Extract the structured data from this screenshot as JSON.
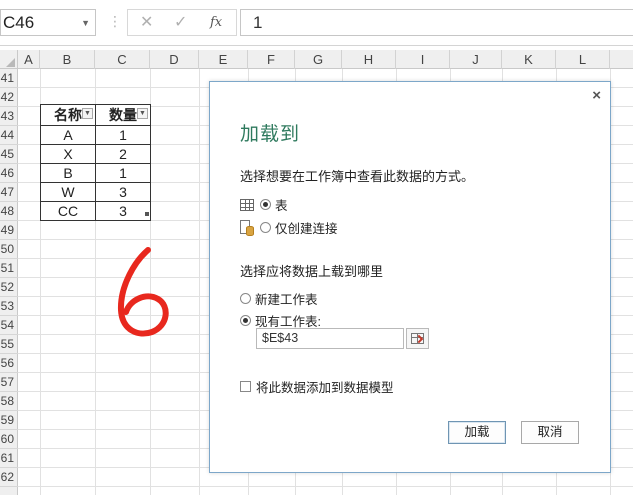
{
  "formula_bar": {
    "name_box": "C46",
    "name_box_dropdown": "▼",
    "separator": "⋮",
    "cancel": "✕",
    "confirm": "✓",
    "fx": "fx",
    "formula": "1"
  },
  "sheet": {
    "columns": [
      "A",
      "B",
      "C",
      "D",
      "E",
      "F",
      "G",
      "H",
      "I",
      "J",
      "K",
      "L"
    ],
    "rows": [
      "41",
      "42",
      "43",
      "44",
      "45",
      "46",
      "47",
      "48",
      "49",
      "50",
      "51",
      "52",
      "53",
      "54",
      "55",
      "56",
      "57",
      "58",
      "59",
      "60",
      "61",
      "62"
    ],
    "table": {
      "headers": [
        "名称",
        "数量"
      ],
      "rows": [
        [
          "A",
          "1"
        ],
        [
          "X",
          "2"
        ],
        [
          "B",
          "1"
        ],
        [
          "W",
          "3"
        ],
        [
          "CC",
          "3"
        ]
      ]
    }
  },
  "dialog": {
    "close": "×",
    "title": "加载到",
    "section1": "选择想要在工作簿中查看此数据的方式。",
    "option_table": "表",
    "option_connection": "仅创建连接",
    "section2": "选择应将数据上载到哪里",
    "option_new_sheet": "新建工作表",
    "option_existing_sheet": "现有工作表:",
    "cell_ref": "$E$43",
    "add_to_model": "将此数据添加到数据模型",
    "load_button": "加载",
    "cancel_button": "取消"
  },
  "colors": {
    "title_green": "#2f7a5e",
    "scribble_red": "#e8281e",
    "dialog_border": "#7da7c9"
  }
}
